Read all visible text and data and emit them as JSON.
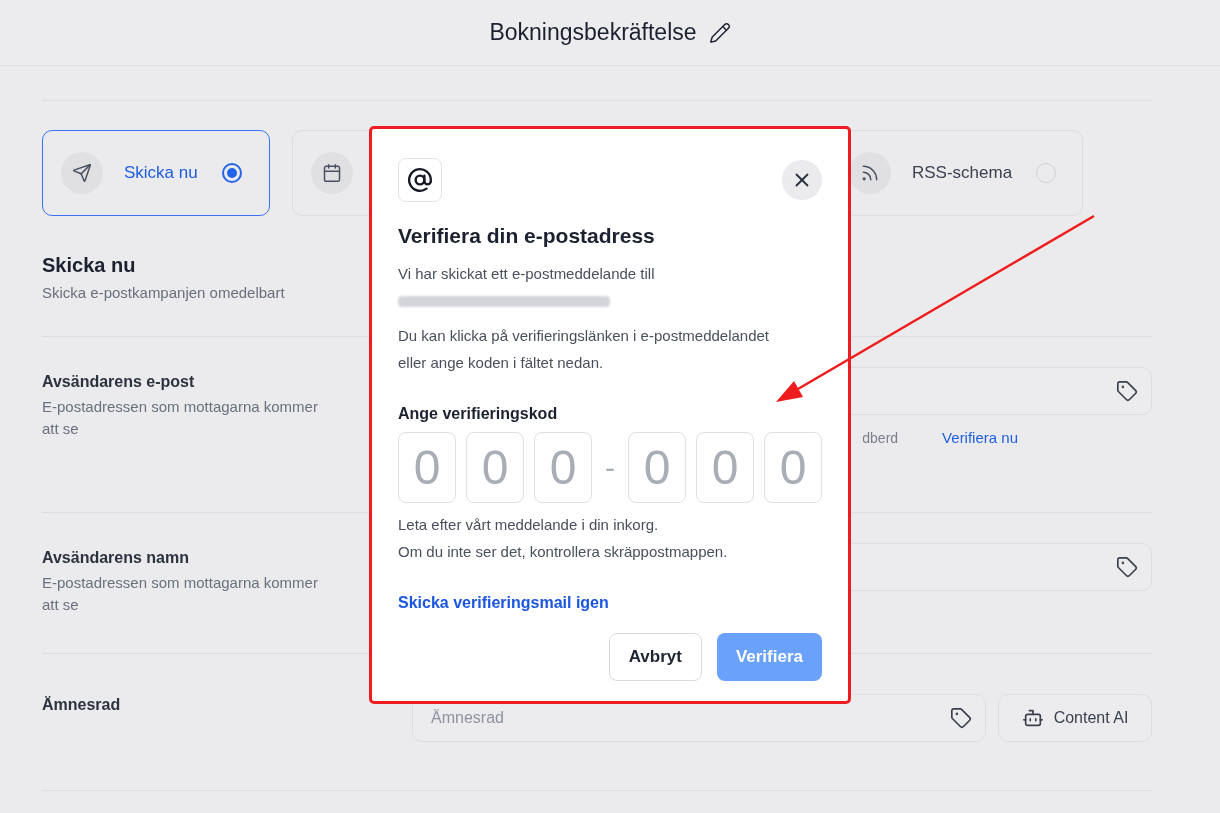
{
  "header": {
    "title": "Bokningsbekräftelse"
  },
  "send_options": [
    {
      "label": "Skicka nu",
      "selected": true
    },
    {
      "label": "RSS-schema",
      "selected": false
    }
  ],
  "section": {
    "title": "Skicka nu",
    "subtitle": "Skicka e-postkampanjen omedelbart"
  },
  "fields": [
    {
      "kind": "verifiable",
      "label": "Avsändarens e-post",
      "description": "E-postadressen som mottagarna kommer att se",
      "status_text": "dberd",
      "action_link": "Verifiera nu"
    },
    {
      "kind": "plain",
      "label": "Avsändarens namn",
      "description": "E-postadressen som mottagarna kommer att se"
    },
    {
      "kind": "assisted",
      "label": "Ämnesrad",
      "placeholder": "Ämnesrad",
      "button": "Content AI"
    }
  ],
  "dialog": {
    "title": "Verifiera din e-postadress",
    "sent_to_text": "Vi har skickat ett e-postmeddelande till",
    "instructions": "Du kan klicka på verifieringslänken i e-postmeddelandet eller ange koden i fältet nedan.",
    "code_label": "Ange verifieringskod",
    "code_groups": [
      [
        {
          "placeholder": "0"
        },
        {
          "placeholder": "0"
        },
        {
          "placeholder": "0"
        }
      ],
      [
        {
          "placeholder": "0"
        },
        {
          "placeholder": "0"
        },
        {
          "placeholder": "0"
        }
      ]
    ],
    "code_separator": "-",
    "hint_lines": [
      "Leta efter vårt meddelande i din inkorg.",
      "Om du inte ser det, kontrollera skräppostmappen."
    ],
    "resend_link": "Skicka verifieringsmail igen",
    "buttons": [
      {
        "kind": "secondary",
        "label": "Avbryt",
        "disabled": false
      },
      {
        "kind": "primary",
        "label": "Verifiera",
        "disabled": true
      }
    ]
  }
}
